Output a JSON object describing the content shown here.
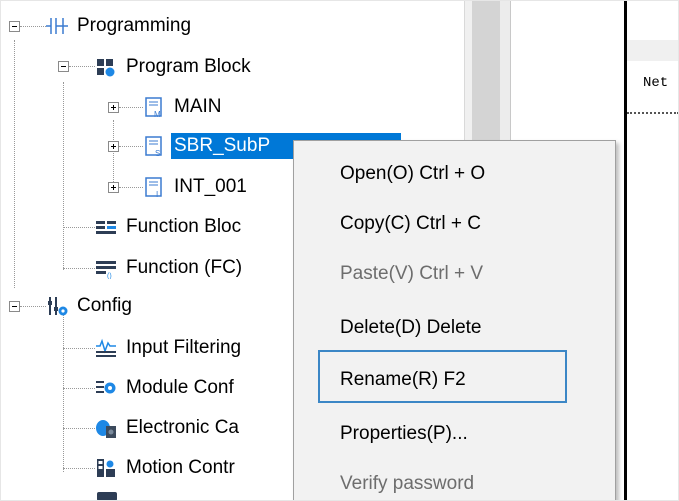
{
  "tree": {
    "nodes": [
      {
        "label": "Programming",
        "icon": "ladder-contacts-icon",
        "expander": "minus"
      },
      {
        "label": "Program Block",
        "icon": "program-block-icon",
        "expander": "minus"
      },
      {
        "label": "MAIN",
        "icon": "main-program-icon",
        "expander": "plus"
      },
      {
        "label": "SBR_SubP",
        "icon": "subroutine-icon",
        "expander": "plus",
        "selected": true
      },
      {
        "label": "INT_001",
        "icon": "interrupt-icon",
        "expander": "plus"
      },
      {
        "label": "Function Bloc",
        "icon": "function-block-icon"
      },
      {
        "label": "Function (FC)",
        "icon": "function-fc-icon"
      },
      {
        "label": "Config",
        "icon": "config-icon",
        "expander": "minus"
      },
      {
        "label": "Input Filtering",
        "icon": "input-filtering-icon"
      },
      {
        "label": "Module Conf",
        "icon": "module-config-icon"
      },
      {
        "label": "Electronic Ca",
        "icon": "electronic-cam-icon"
      },
      {
        "label": "Motion Contr",
        "icon": "motion-control-icon"
      }
    ]
  },
  "editor": {
    "net_label": "Net"
  },
  "context_menu": {
    "items": [
      {
        "label": "Open(O) Ctrl + O",
        "enabled": true
      },
      {
        "label": "Copy(C) Ctrl + C",
        "enabled": true
      },
      {
        "label": "Paste(V) Ctrl + V",
        "enabled": false
      },
      {
        "label": "Delete(D) Delete",
        "enabled": true
      },
      {
        "label": "Rename(R) F2",
        "enabled": true,
        "highlighted": true
      },
      {
        "label": "Properties(P)...",
        "enabled": true
      },
      {
        "label": "Verify password",
        "enabled": false
      }
    ]
  },
  "colors": {
    "selection": "#0078d7",
    "highlight_border": "#3c87c6",
    "menu_background": "#f2f2f2",
    "disabled_text": "#6d6d6d"
  }
}
